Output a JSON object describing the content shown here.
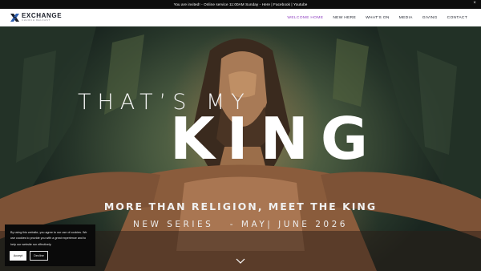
{
  "announcement": {
    "text": "You are invited! - Online service 11:00AM Sunday - Here | Facebook | Youtube",
    "close_glyph": "×"
  },
  "brand": {
    "name": "EXCHANGE",
    "sub": "CHURCH BELFAST",
    "accent": "#8e3fc0"
  },
  "nav": {
    "items": [
      {
        "label": "WELCOME HOME",
        "active": true
      },
      {
        "label": "NEW HERE",
        "active": false
      },
      {
        "label": "WHAT'S ON",
        "active": false
      },
      {
        "label": "MEDIA",
        "active": false
      },
      {
        "label": "GIVING",
        "active": false
      },
      {
        "label": "CONTACT",
        "active": false
      }
    ]
  },
  "hero": {
    "title_line1": "THAT’S MY",
    "title_line2": "KING",
    "subtitle": "MORE THAN RELIGION, MEET THE KING",
    "series": "NEW SERIES   - MAY| JUNE 2026",
    "scroll_icon": "chevron-down-icon"
  },
  "cookie": {
    "text": "By using this website, you agree to our use of cookies. We use cookies to provide you with a great experience and to help our website run effectively.",
    "accept_label": "Accept",
    "decline_label": "Decline"
  }
}
